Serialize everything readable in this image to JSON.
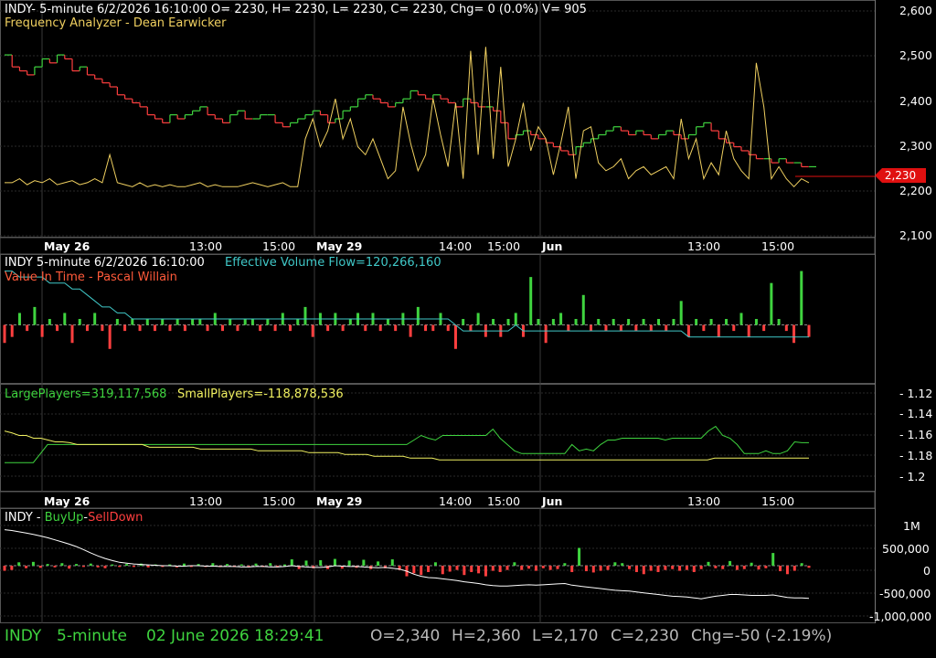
{
  "colors": {
    "background": "#000000",
    "grid": "#2a2a2a",
    "axis": "#9a9a9a",
    "up": "#3fd43f",
    "down": "#ff3f3f",
    "price_line": "#d0d0d0",
    "freq": "#f0d060",
    "evf": "#40c8c8",
    "large": "#3fd43f",
    "small": "#f0f060",
    "title_orange": "#ff9f3f",
    "value_red": "#ff5a3a"
  },
  "panes": {
    "price": {
      "header": "INDY- 5-minute 6/2/2026 16:10:00 O= 2230, H= 2230, L= 2230, C= 2230, Chg= 0 (0.0%) V= 905",
      "subtitle": "Frequency Analyzer - Dean Earwicker",
      "last_price_label": "2,230",
      "y_ticks": [
        "2,600",
        "2,500",
        "2,400",
        "2,300",
        "2,200",
        "2,100"
      ]
    },
    "volume": {
      "header_left": "INDY 5-minute  6/2/2026 16:10:00",
      "header_right": "Effective Volume Flow=120,266,160",
      "subtitle": "Value In Time - Pascal Willain"
    },
    "players": {
      "large": "LargePlayers=319,117,568",
      "small": "SmallPlayers=-118,878,536",
      "y_ticks": [
        "- 1.12",
        "- 1.14",
        "- 1.16",
        "- 1.18",
        "- 1.2"
      ]
    },
    "buysell": {
      "title_prefix": "INDY - ",
      "buy": "BuyUp",
      "sep": "-",
      "sell": "SellDown",
      "y_ticks": [
        "1M",
        "500,000",
        "0",
        "-500,000",
        "-1,000,000"
      ]
    }
  },
  "x_axis_labels": [
    {
      "text": "May 26",
      "bold": true
    },
    {
      "text": "13:00",
      "bold": false
    },
    {
      "text": "15:00",
      "bold": false
    },
    {
      "text": "May 29",
      "bold": true
    },
    {
      "text": "14:00",
      "bold": false
    },
    {
      "text": "15:00",
      "bold": false
    },
    {
      "text": "Jun",
      "bold": true
    },
    {
      "text": "13:00",
      "bold": false
    },
    {
      "text": "15:00",
      "bold": false
    }
  ],
  "status_bar": {
    "symbol": "INDY",
    "interval": "5-minute",
    "datetime": "02 June 2026 18:29:41",
    "open": "O=2,340",
    "high": "H=2,360",
    "low": "L=2,170",
    "close": "C=2,230",
    "change": "Chg=-50 (-2.19%)"
  },
  "chart_data": [
    {
      "type": "line",
      "pane": "price",
      "series": [
        {
          "name": "INDY",
          "values": [
            2510,
            2480,
            2470,
            2460,
            2480,
            2500,
            2490,
            2510,
            2500,
            2470,
            2480,
            2460,
            2450,
            2440,
            2430,
            2410,
            2400,
            2390,
            2380,
            2360,
            2350,
            2340,
            2360,
            2350,
            2360,
            2370,
            2380,
            2360,
            2350,
            2340,
            2360,
            2370,
            2350,
            2350,
            2360,
            2360,
            2340,
            2330,
            2340,
            2350,
            2360,
            2370,
            2360,
            2340,
            2350,
            2370,
            2380,
            2400,
            2410,
            2400,
            2390,
            2380,
            2390,
            2400,
            2420,
            2410,
            2400,
            2410,
            2400,
            2390,
            2380,
            2400,
            2390,
            2380,
            2380,
            2370,
            2340,
            2300,
            2310,
            2320,
            2310,
            2300,
            2290,
            2280,
            2270,
            2260,
            2280,
            2290,
            2300,
            2310,
            2320,
            2330,
            2320,
            2310,
            2320,
            2310,
            2300,
            2310,
            2320,
            2310,
            2300,
            2310,
            2330,
            2340,
            2320,
            2300,
            2290,
            2280,
            2270,
            2260,
            2250,
            2250,
            2240,
            2250,
            2240,
            2240,
            2230,
            2230
          ]
        },
        {
          "name": "Frequency Analyzer",
          "values": [
            2190,
            2190,
            2200,
            2185,
            2195,
            2190,
            2200,
            2185,
            2190,
            2195,
            2185,
            2190,
            2200,
            2190,
            2260,
            2190,
            2185,
            2180,
            2190,
            2180,
            2185,
            2180,
            2185,
            2180,
            2180,
            2185,
            2190,
            2180,
            2185,
            2180,
            2180,
            2180,
            2185,
            2190,
            2185,
            2180,
            2185,
            2190,
            2180,
            2180,
            2300,
            2350,
            2280,
            2320,
            2400,
            2300,
            2350,
            2280,
            2260,
            2300,
            2250,
            2200,
            2220,
            2380,
            2290,
            2220,
            2260,
            2400,
            2310,
            2230,
            2390,
            2200,
            2520,
            2260,
            2530,
            2250,
            2480,
            2230,
            2300,
            2390,
            2270,
            2330,
            2300,
            2210,
            2290,
            2380,
            2200,
            2320,
            2330,
            2240,
            2220,
            2230,
            2250,
            2200,
            2220,
            2230,
            2210,
            2220,
            2230,
            2200,
            2350,
            2250,
            2300,
            2200,
            2240,
            2210,
            2320,
            2250,
            2220,
            2200,
            2490,
            2380,
            2200,
            2230,
            2200,
            2180,
            2200,
            2190
          ]
        }
      ],
      "ylim": [
        2080,
        2620
      ]
    },
    {
      "type": "bar",
      "pane": "volume",
      "series": [
        {
          "name": "Value In Time",
          "values": [
            -3,
            -2,
            2,
            -1,
            3,
            -2,
            1,
            -1,
            2,
            -3,
            1,
            -1,
            2,
            -1,
            -4,
            1,
            -1,
            1,
            -1,
            1,
            -1,
            1,
            -1,
            1,
            -1,
            1,
            1,
            -1,
            2,
            -1,
            1,
            -1,
            1,
            1,
            -1,
            1,
            -1,
            2,
            -1,
            1,
            3,
            -2,
            2,
            -1,
            2,
            -1,
            1,
            2,
            -1,
            2,
            -1,
            1,
            -1,
            2,
            -2,
            3,
            -1,
            -1,
            2,
            -1,
            -4,
            1,
            -1,
            2,
            -2,
            1,
            -2,
            1,
            2,
            -2,
            8,
            1,
            -3,
            1,
            2,
            -1,
            1,
            5,
            -1,
            1,
            -1,
            1,
            -1,
            1,
            -1,
            1,
            -1,
            1,
            -1,
            1,
            4,
            -2,
            1,
            -1,
            1,
            -2,
            1,
            -1,
            2,
            -2,
            1,
            -1,
            7,
            1,
            -1,
            -3,
            9,
            -2
          ]
        },
        {
          "name": "Effective Volume Flow",
          "values": [
            9,
            9,
            8,
            8,
            8,
            8,
            7,
            7,
            7,
            6,
            6,
            5,
            4,
            3,
            3,
            2,
            2,
            1,
            1,
            1,
            1,
            1,
            1,
            1,
            1,
            1,
            1,
            1,
            1,
            1,
            1,
            1,
            1,
            1,
            1,
            1,
            1,
            1,
            1,
            1,
            1,
            1,
            1,
            1,
            1,
            1,
            1,
            1,
            1,
            1,
            1,
            1,
            1,
            1,
            1,
            1,
            1,
            1,
            1,
            1,
            0,
            -1,
            -1,
            -1,
            -1,
            -1,
            -1,
            -1,
            0,
            -1,
            -1,
            -1,
            -1,
            -1,
            -1,
            -1,
            -1,
            -1,
            -1,
            -1,
            -1,
            -1,
            -1,
            -1,
            -1,
            -1,
            -1,
            -1,
            -1,
            -1,
            -1,
            -2,
            -2,
            -2,
            -2,
            -2,
            -2,
            -2,
            -2,
            -2,
            -2,
            -2,
            -2,
            -2,
            -2,
            -2,
            -2,
            -2
          ]
        }
      ],
      "ylim": [
        -8,
        10
      ]
    },
    {
      "type": "line",
      "pane": "players",
      "series": [
        {
          "name": "LargePlayers",
          "values": [
            1.185,
            1.185,
            1.185,
            1.185,
            1.185,
            1.175,
            1.165,
            1.165,
            1.165,
            1.165,
            1.165,
            1.165,
            1.165,
            1.165,
            1.165,
            1.165,
            1.165,
            1.165,
            1.165,
            1.165,
            1.165,
            1.165,
            1.165,
            1.165,
            1.165,
            1.165,
            1.165,
            1.165,
            1.165,
            1.165,
            1.165,
            1.165,
            1.165,
            1.165,
            1.165,
            1.165,
            1.165,
            1.165,
            1.165,
            1.165,
            1.165,
            1.165,
            1.165,
            1.165,
            1.165,
            1.165,
            1.165,
            1.165,
            1.165,
            1.165,
            1.165,
            1.165,
            1.165,
            1.165,
            1.165,
            1.165,
            1.165,
            1.16,
            1.155,
            1.158,
            1.16,
            1.155,
            1.155,
            1.155,
            1.155,
            1.155,
            1.155,
            1.155,
            1.148,
            1.158,
            1.165,
            1.172,
            1.175,
            1.175,
            1.175,
            1.175,
            1.175,
            1.175,
            1.175,
            1.165,
            1.172,
            1.17,
            1.172,
            1.165,
            1.16,
            1.16,
            1.158,
            1.158,
            1.158,
            1.158,
            1.158,
            1.158,
            1.16,
            1.158,
            1.158,
            1.158,
            1.158,
            1.158,
            1.15,
            1.145,
            1.155,
            1.158,
            1.165,
            1.175,
            1.175,
            1.175,
            1.172,
            1.175,
            1.175,
            1.172,
            1.162,
            1.163,
            1.163
          ]
        },
        {
          "name": "SmallPlayers",
          "values": [
            1.15,
            1.152,
            1.155,
            1.155,
            1.158,
            1.158,
            1.16,
            1.162,
            1.162,
            1.163,
            1.165,
            1.165,
            1.165,
            1.165,
            1.165,
            1.165,
            1.165,
            1.165,
            1.165,
            1.165,
            1.168,
            1.168,
            1.168,
            1.168,
            1.168,
            1.168,
            1.168,
            1.17,
            1.17,
            1.17,
            1.17,
            1.17,
            1.17,
            1.17,
            1.17,
            1.172,
            1.172,
            1.172,
            1.172,
            1.172,
            1.172,
            1.172,
            1.174,
            1.174,
            1.174,
            1.174,
            1.174,
            1.176,
            1.176,
            1.176,
            1.176,
            1.178,
            1.178,
            1.178,
            1.178,
            1.178,
            1.18,
            1.18,
            1.18,
            1.18,
            1.182,
            1.182,
            1.182,
            1.182,
            1.182,
            1.182,
            1.182,
            1.182,
            1.182,
            1.182,
            1.182,
            1.182,
            1.182,
            1.182,
            1.182,
            1.182,
            1.182,
            1.182,
            1.182,
            1.182,
            1.182,
            1.182,
            1.182,
            1.182,
            1.182,
            1.182,
            1.182,
            1.182,
            1.182,
            1.182,
            1.182,
            1.182,
            1.182,
            1.182,
            1.182,
            1.182,
            1.182,
            1.182,
            1.18,
            1.18,
            1.18,
            1.18,
            1.18,
            1.18,
            1.18,
            1.18,
            1.18,
            1.18,
            1.18,
            1.18,
            1.18,
            1.18
          ]
        }
      ],
      "ylim": [
        1.205,
        1.11
      ]
    },
    {
      "type": "bar",
      "pane": "buysell",
      "series": [
        {
          "name": "BuyUp-SellDown",
          "values": [
            -120000,
            -100000,
            80000,
            -60000,
            90000,
            -50000,
            40000,
            -40000,
            60000,
            -70000,
            40000,
            -30000,
            50000,
            -40000,
            -60000,
            30000,
            -30000,
            40000,
            -30000,
            50000,
            -40000,
            30000,
            -30000,
            30000,
            -40000,
            50000,
            -30000,
            40000,
            -30000,
            60000,
            -30000,
            40000,
            -30000,
            30000,
            -40000,
            50000,
            -30000,
            60000,
            -40000,
            30000,
            150000,
            -80000,
            120000,
            -60000,
            130000,
            -80000,
            160000,
            -70000,
            120000,
            -50000,
            140000,
            -80000,
            100000,
            -60000,
            150000,
            -100000,
            -250000,
            -180000,
            -220000,
            -150000,
            80000,
            -200000,
            -140000,
            -100000,
            -220000,
            -150000,
            -180000,
            -250000,
            -120000,
            -150000,
            -100000,
            80000,
            -100000,
            -70000,
            -120000,
            -60000,
            -100000,
            -80000,
            60000,
            -150000,
            420000,
            -130000,
            -160000,
            -120000,
            -100000,
            80000,
            60000,
            -80000,
            -150000,
            -200000,
            -120000,
            -150000,
            -100000,
            -80000,
            -120000,
            -100000,
            -150000,
            -80000,
            90000,
            -60000,
            -80000,
            110000,
            -100000,
            -80000,
            70000,
            -90000,
            -60000,
            300000,
            -130000,
            -200000,
            -120000,
            60000,
            -50000
          ]
        },
        {
          "name": "Cumulative",
          "values": [
            850000,
            830000,
            800000,
            770000,
            740000,
            700000,
            660000,
            610000,
            560000,
            510000,
            450000,
            380000,
            300000,
            230000,
            170000,
            120000,
            80000,
            60000,
            40000,
            30000,
            20000,
            10000,
            0,
            0,
            -10000,
            -10000,
            0,
            0,
            -10000,
            -10000,
            -20000,
            -20000,
            -20000,
            -30000,
            -30000,
            -20000,
            -20000,
            -30000,
            -30000,
            -20000,
            0,
            -20000,
            -30000,
            -40000,
            -40000,
            -30000,
            0,
            -10000,
            -20000,
            -20000,
            -30000,
            -40000,
            -50000,
            -40000,
            -60000,
            -80000,
            -130000,
            -200000,
            -250000,
            -280000,
            -290000,
            -310000,
            -330000,
            -350000,
            -380000,
            -400000,
            -420000,
            -450000,
            -470000,
            -480000,
            -480000,
            -470000,
            -460000,
            -450000,
            -460000,
            -450000,
            -440000,
            -430000,
            -420000,
            -460000,
            -480000,
            -500000,
            -520000,
            -540000,
            -560000,
            -580000,
            -590000,
            -600000,
            -620000,
            -640000,
            -660000,
            -680000,
            -700000,
            -720000,
            -730000,
            -740000,
            -760000,
            -780000,
            -750000,
            -720000,
            -700000,
            -680000,
            -680000,
            -690000,
            -700000,
            -700000,
            -700000,
            -690000,
            -720000,
            -750000,
            -760000,
            -760000,
            -770000
          ]
        }
      ],
      "ylim": [
        -1100000,
        1100000
      ]
    }
  ]
}
